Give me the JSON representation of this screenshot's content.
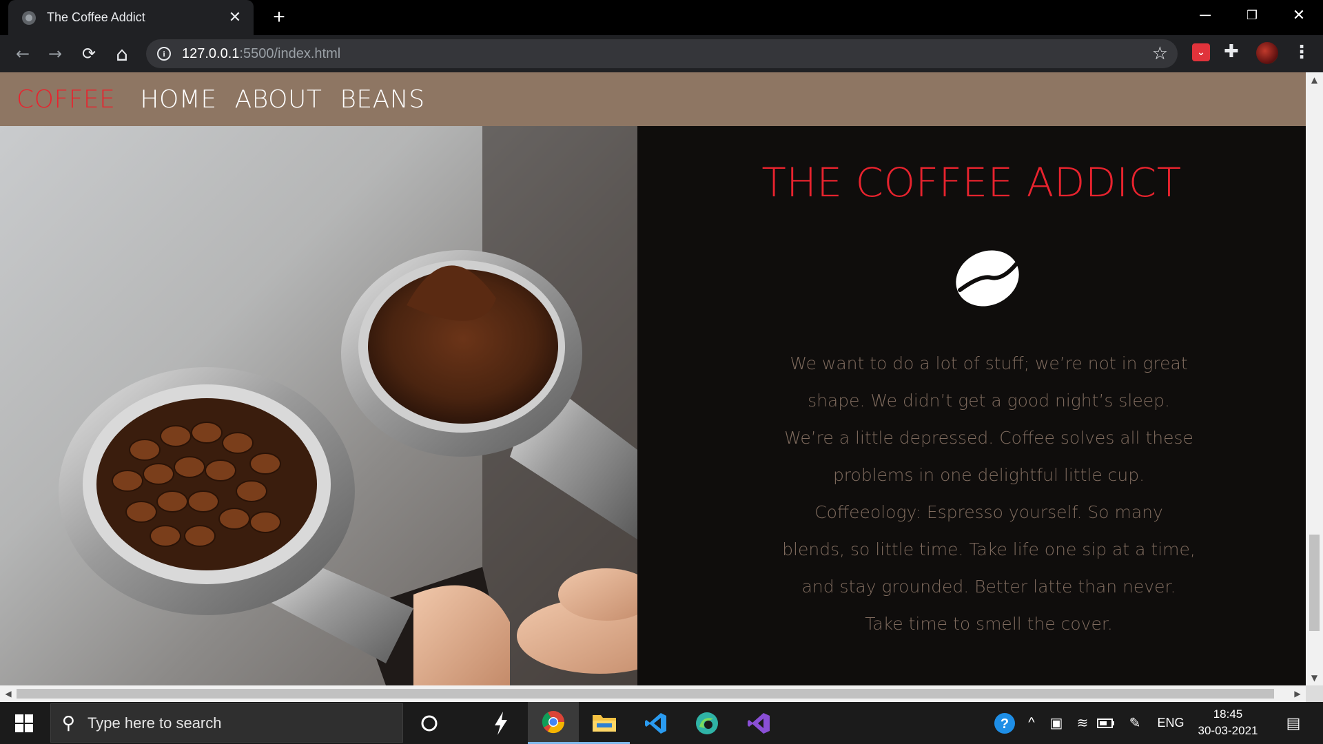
{
  "browser": {
    "tab_title": "The Coffee Addict",
    "tab_close": "✕",
    "new_tab": "+",
    "url_host": "127.0.0.1",
    "url_rest": ":5500/index.html",
    "window_minimize": "─",
    "window_restore": "❐",
    "window_close": "✕",
    "back": "←",
    "forward": "→",
    "reload": "⟳",
    "home": "⌂",
    "star": "☆",
    "menu": "⋮"
  },
  "page": {
    "nav": {
      "brand": "COFFEE",
      "links": [
        "HOME",
        "ABOUT",
        "BEANS"
      ]
    },
    "hero_title": "THE COFFEE ADDICT",
    "body_text": "We want to do a lot of stuff; we’re not in great shape. We didn’t get a good night’s sleep. We’re a little depressed. Coffee solves all these problems in one delightful little cup. Coffeeology: Espresso yourself. So many blends, so little time. Take life one sip at a time, and stay grounded. Better latte than never. Take time to smell the cover.",
    "colors": {
      "navbar": "#8e7663",
      "accent_red": "#e8232e",
      "body_text": "#7f6b5e",
      "content_bg": "#0f0d0c"
    },
    "icons": [
      "coffee-bean-icon",
      "portafilter-photo"
    ]
  },
  "taskbar": {
    "search_placeholder": "Type here to search",
    "language": "ENG",
    "time": "18:45",
    "date": "30-03-2021",
    "apps": [
      "cortana-icon",
      "unknown-app-icon",
      "chrome-icon",
      "file-explorer-icon",
      "vscode-icon",
      "edge-icon",
      "visual-studio-icon"
    ]
  }
}
